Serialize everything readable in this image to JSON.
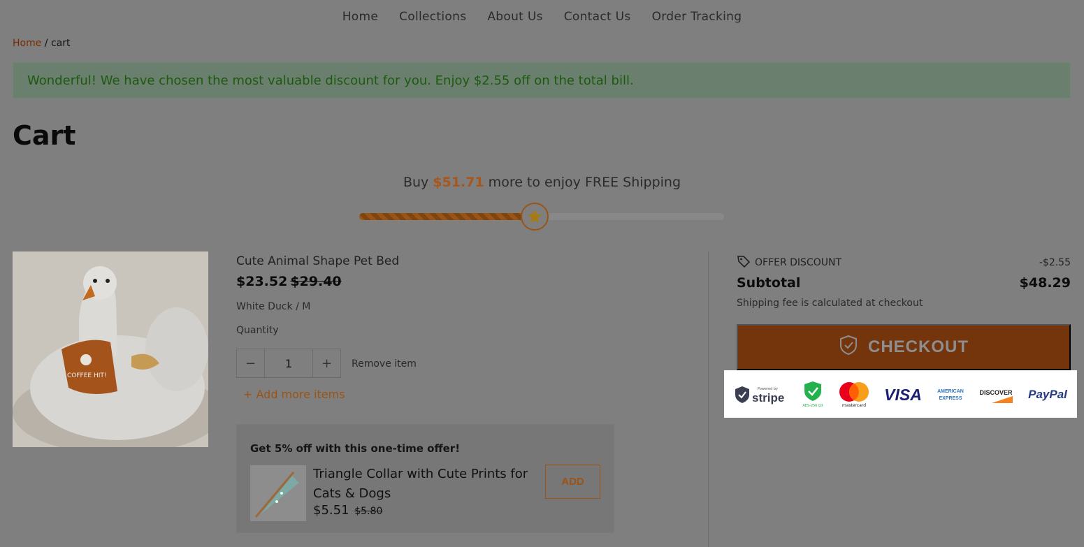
{
  "nav": {
    "items": [
      "Home",
      "Collections",
      "About Us",
      "Contact Us",
      "Order Tracking"
    ]
  },
  "breadcrumb": {
    "home": "Home",
    "separator": " / ",
    "current": "cart"
  },
  "notice": {
    "text": "Wonderful! We have chosen the most valuable discount for you. Enjoy $2.55 off on the total bill."
  },
  "page": {
    "title": "Cart"
  },
  "shipping": {
    "prefix": "Buy ",
    "amount": "$51.71",
    "suffix": " more to enjoy FREE Shipping",
    "progress_fraction": 0.48
  },
  "item": {
    "name": "Cute Animal Shape Pet Bed",
    "price": "$23.52",
    "compare_price": "$29.40",
    "variant": "White Duck / M",
    "quantity_label": "Quantity",
    "quantity": "1",
    "minus": "−",
    "plus": "+",
    "remove_label": "Remove item",
    "image_text": "COFFEE HIT!"
  },
  "add_more": {
    "label": "+ Add more items"
  },
  "upsell": {
    "title": "Get 5% off with this one-time offer!",
    "name": "Triangle Collar with Cute Prints for Cats & Dogs",
    "price": "$5.51",
    "old_price": "$5.80",
    "add_label": "ADD"
  },
  "summary": {
    "offer_label": "OFFER DISCOUNT",
    "offer_value": "-$2.55",
    "subtotal_label": "Subtotal",
    "subtotal_value": "$48.29",
    "ship_note": "Shipping fee is calculated at checkout",
    "checkout_label": "CHECKOUT"
  },
  "payments": {
    "stripe_top": "Powered by",
    "stripe": "stripe",
    "aes": "AES-256 bit",
    "mastercard": "mastercard",
    "visa": "VISA",
    "amex_1": "AMERICAN",
    "amex_2": "EXPRESS",
    "discover": "DISCOVER",
    "paypal": "PayPal"
  },
  "colors": {
    "accent": "#9a5415",
    "checkout_bg": "#74350c",
    "notice_text": "#1d5a10",
    "overlay_bg": "#7f7f7f"
  }
}
